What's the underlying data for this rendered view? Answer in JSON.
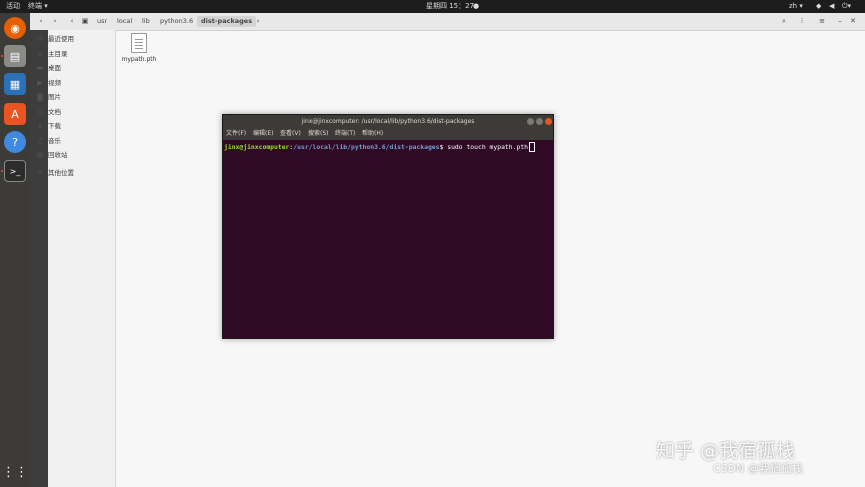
{
  "topbar": {
    "activities": "活动",
    "app_menu": "终端 ▾",
    "clock": "星期四 15：27",
    "lang": "zh ▾"
  },
  "dock": {
    "apps": [
      "firefox",
      "files",
      "writer",
      "software",
      "help",
      "terminal"
    ]
  },
  "sidebar": {
    "items": [
      {
        "label": "最近使用",
        "icon": "clock-icon"
      },
      {
        "label": "主目录",
        "icon": "home-icon"
      },
      {
        "label": "桌面",
        "icon": "folder-icon"
      },
      {
        "label": "视频",
        "icon": "video-icon"
      },
      {
        "label": "图片",
        "icon": "camera-icon"
      },
      {
        "label": "文档",
        "icon": "document-icon"
      },
      {
        "label": "下载",
        "icon": "download-icon"
      },
      {
        "label": "音乐",
        "icon": "music-icon"
      },
      {
        "label": "回收站",
        "icon": "trash-icon"
      },
      {
        "label": "其他位置",
        "icon": "plus-icon"
      }
    ]
  },
  "breadcrumb": [
    "usr",
    "local",
    "lib",
    "python3.6",
    "dist-packages"
  ],
  "files": [
    {
      "name": "mypath.pth"
    }
  ],
  "terminal": {
    "title": "jinx@jinxcomputer: /usr/local/lib/python3.6/dist-packages",
    "menu": [
      "文件(F)",
      "编辑(E)",
      "查看(V)",
      "搜索(S)",
      "终端(T)",
      "帮助(H)"
    ],
    "prompt_user": "jinx@jinxcomputer",
    "prompt_path": "/usr/local/lib/python3.6/dist-packages",
    "prompt_symbol": "$",
    "command": "sudo touch mypath.pth"
  },
  "watermarks": {
    "zhihu": "知乎 @我宿孤栈",
    "csdn": "CSDN @我宿孤栈"
  }
}
